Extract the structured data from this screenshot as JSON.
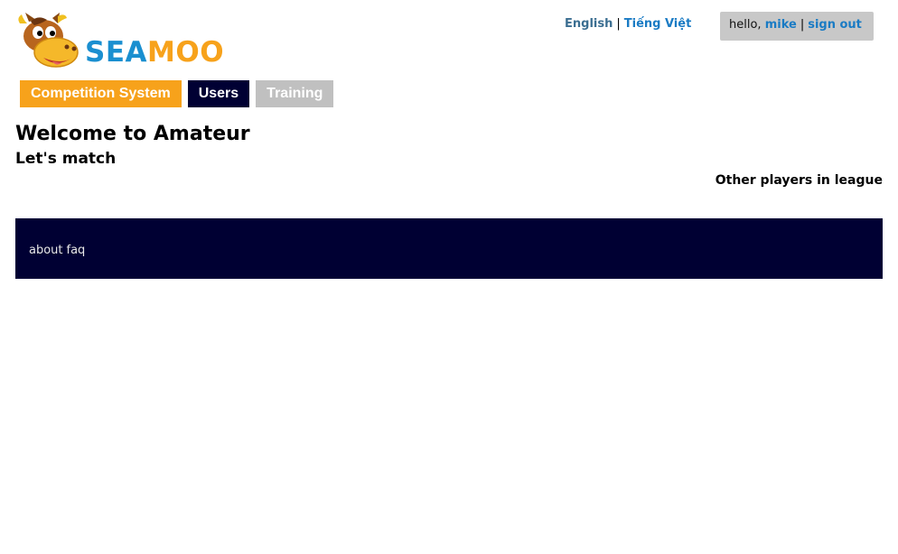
{
  "header": {
    "logo": {
      "word_part1": "SEA",
      "word_part2": "MOO",
      "colors": {
        "sea": "#1a8fd0",
        "moo": "#f7a21b"
      },
      "icon": "horse-mascot-icon"
    },
    "languages": {
      "english": "English",
      "vietnamese": "Tiếng Việt",
      "separator": "|"
    },
    "user": {
      "greeting": "hello,",
      "username": "mike",
      "separator": "|",
      "sign_out": "sign out"
    }
  },
  "nav": {
    "items": [
      {
        "label": "Competition System",
        "color": "#f7a21b"
      },
      {
        "label": "Users",
        "color": "#000033"
      },
      {
        "label": "Training",
        "color": "#c0c0c0"
      }
    ]
  },
  "main": {
    "title": "Welcome to Amateur",
    "subtitle": "Let's match",
    "other_players": "Other players in league"
  },
  "footer": {
    "links": [
      "about",
      "faq"
    ],
    "background": "#000033"
  }
}
